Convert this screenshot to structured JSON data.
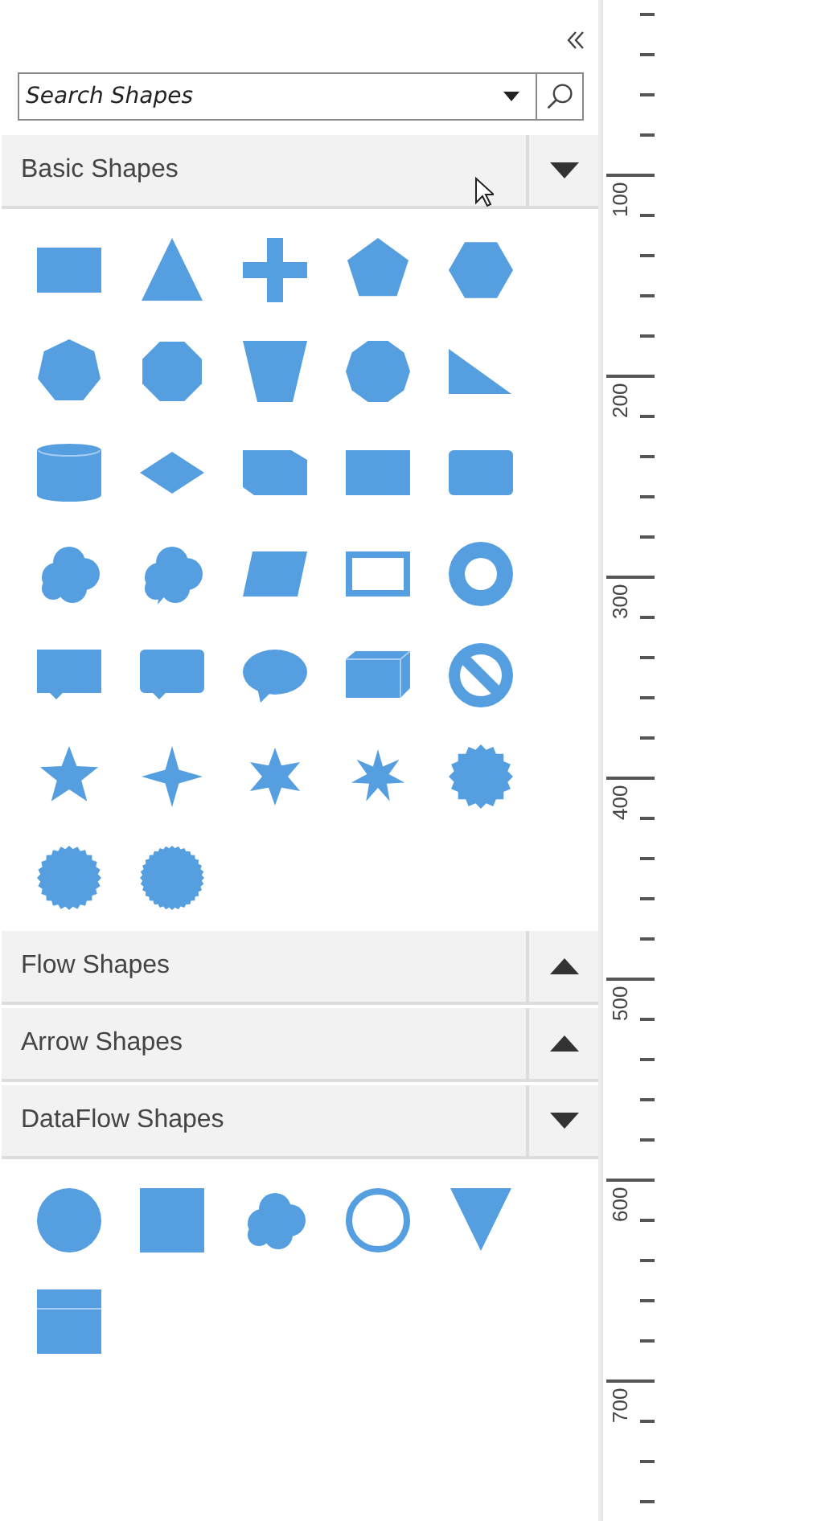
{
  "search": {
    "placeholder": "Search Shapes"
  },
  "palettes": [
    {
      "title": "Basic Shapes",
      "expanded": true,
      "shapes": [
        {
          "kind": "rectangle"
        },
        {
          "kind": "triangle"
        },
        {
          "kind": "plus"
        },
        {
          "kind": "pentagon"
        },
        {
          "kind": "hexagon"
        },
        {
          "kind": "heptagon"
        },
        {
          "kind": "octagon"
        },
        {
          "kind": "trapezoid"
        },
        {
          "kind": "decagon"
        },
        {
          "kind": "right-triangle"
        },
        {
          "kind": "cylinder"
        },
        {
          "kind": "diamond"
        },
        {
          "kind": "card"
        },
        {
          "kind": "rectangle"
        },
        {
          "kind": "rounded-rectangle"
        },
        {
          "kind": "cloud"
        },
        {
          "kind": "thought-bubble"
        },
        {
          "kind": "parallelogram"
        },
        {
          "kind": "frame"
        },
        {
          "kind": "donut"
        },
        {
          "kind": "callout"
        },
        {
          "kind": "rounded-callout"
        },
        {
          "kind": "oval-callout"
        },
        {
          "kind": "cube"
        },
        {
          "kind": "no-symbol"
        },
        {
          "kind": "star5"
        },
        {
          "kind": "star4"
        },
        {
          "kind": "star6"
        },
        {
          "kind": "star7"
        },
        {
          "kind": "burst"
        },
        {
          "kind": "seal24"
        },
        {
          "kind": "seal32"
        }
      ]
    },
    {
      "title": "Flow Shapes",
      "expanded": false
    },
    {
      "title": "Arrow Shapes",
      "expanded": false
    },
    {
      "title": "DataFlow Shapes",
      "expanded": true,
      "shapes": [
        {
          "kind": "circle"
        },
        {
          "kind": "square"
        },
        {
          "kind": "cloud"
        },
        {
          "kind": "ring"
        },
        {
          "kind": "down-triangle"
        },
        {
          "kind": "split-box"
        }
      ]
    }
  ],
  "ruler": {
    "labels": [
      "100",
      "200",
      "300",
      "400",
      "500",
      "600",
      "700"
    ]
  }
}
